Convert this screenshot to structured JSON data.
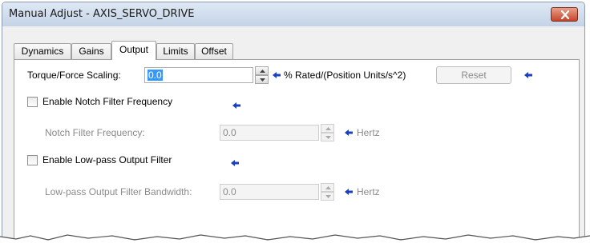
{
  "window": {
    "title": "Manual Adjust - AXIS_SERVO_DRIVE"
  },
  "tabs": [
    {
      "label": "Dynamics",
      "active": false
    },
    {
      "label": "Gains",
      "active": false
    },
    {
      "label": "Output",
      "active": true
    },
    {
      "label": "Limits",
      "active": false
    },
    {
      "label": "Offset",
      "active": false
    }
  ],
  "torque": {
    "label": "Torque/Force Scaling:",
    "value": "0.0",
    "units": "% Rated/(Position Units/s^2)",
    "reset_label": "Reset"
  },
  "notch": {
    "checkbox_label": "Enable Notch Filter Frequency",
    "field_label": "Notch Filter Frequency:",
    "value": "0.0",
    "units": "Hertz"
  },
  "lowpass": {
    "checkbox_label": "Enable Low-pass Output Filter",
    "field_label": "Low-pass Output Filter Bandwidth:",
    "value": "0.0",
    "units": "Hertz"
  },
  "colors": {
    "pointer_arrow": "#1a3fbf",
    "close_button": "#c8452a",
    "selection": "#3399ff"
  },
  "icons": [
    "close-icon",
    "spin-up-icon",
    "spin-down-icon",
    "pointer-arrow-icon"
  ]
}
